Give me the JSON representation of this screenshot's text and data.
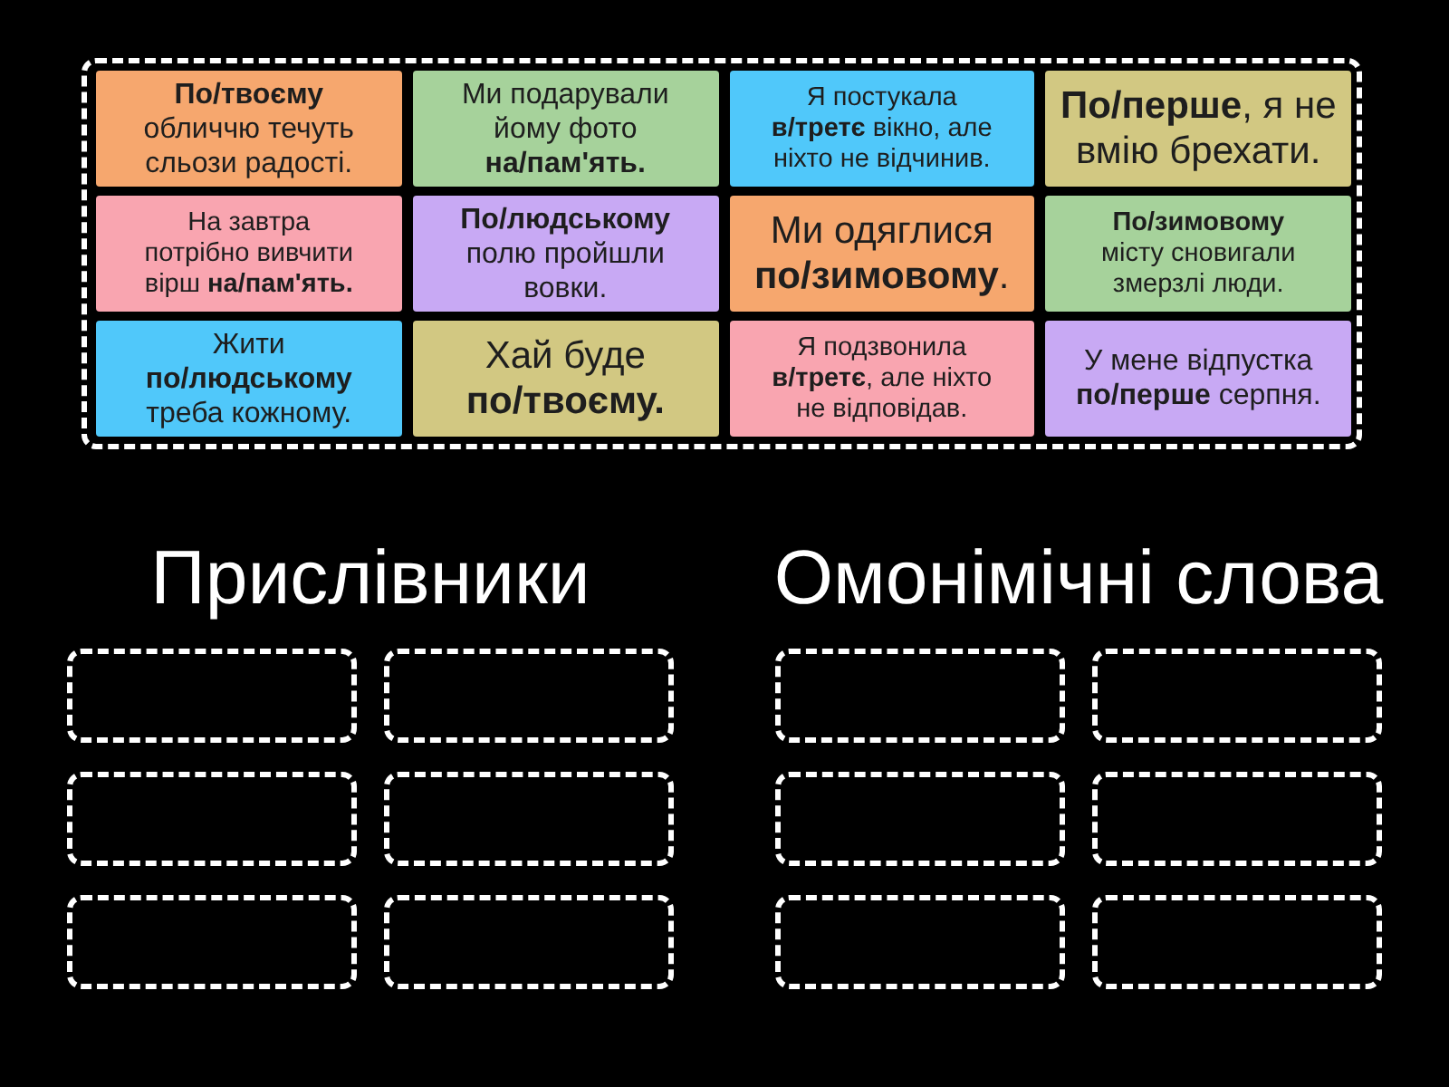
{
  "cards": [
    {
      "text": "**По/твоєму** обличчю течуть сльози радості.",
      "color": "#f6a76e"
    },
    {
      "text": "Ми подарували йому фото **на/пам'ять.**",
      "color": "#a6d29b"
    },
    {
      "text": "Я постукала **в/третє** вікно, але ніхто не відчинив.",
      "color": "#50c8fa"
    },
    {
      "text": "**По/перше**, я не вмію брехати.",
      "color": "#d2c882"
    },
    {
      "text": "На завтра потрібно вивчити вірш **на/пам'ять.**",
      "color": "#f9a5b0"
    },
    {
      "text": "**По/людському** полю пройшли вовки.",
      "color": "#c8a9f4"
    },
    {
      "text": "Ми одяглися **по/зимовому**.",
      "color": "#f6a76e"
    },
    {
      "text": "**По/зимовому** місту сновигали змерзлі люди.",
      "color": "#a6d29b"
    },
    {
      "text": "Жити **по/людському** треба кожному.",
      "color": "#50c8fa"
    },
    {
      "text": "Хай буде **по/твоєму.**",
      "color": "#d2c882"
    },
    {
      "text": "Я подзвонила **в/третє**, але ніхто не відповідав.",
      "color": "#f9a5b0"
    },
    {
      "text": "У мене відпустка **по/перше** серпня.",
      "color": "#c8a9f4"
    }
  ],
  "groups": [
    {
      "title": "Прислівники",
      "slots": [
        {
          "kind": "empty"
        },
        {
          "kind": "empty"
        },
        {
          "kind": "empty"
        },
        {
          "kind": "empty"
        },
        {
          "kind": "empty"
        },
        {
          "kind": "empty"
        }
      ]
    },
    {
      "title": "Омонімічні слова",
      "slots": [
        {
          "kind": "empty"
        },
        {
          "kind": "empty"
        },
        {
          "kind": "empty"
        },
        {
          "kind": "empty"
        },
        {
          "kind": "empty"
        },
        {
          "kind": "empty"
        }
      ]
    }
  ]
}
